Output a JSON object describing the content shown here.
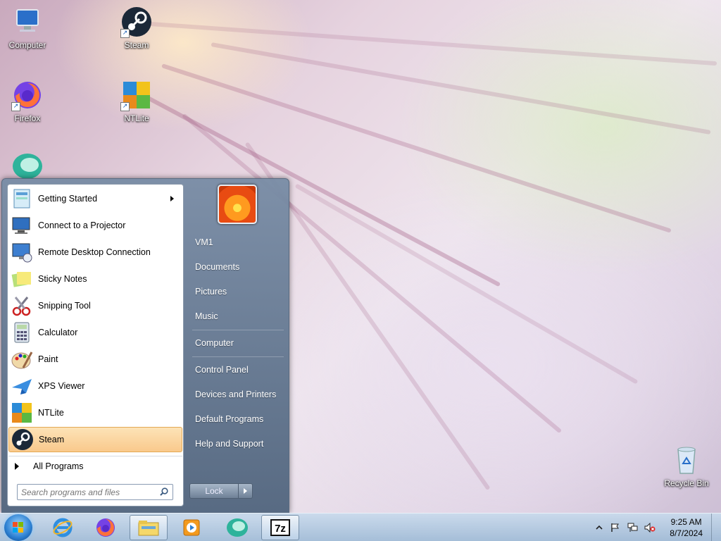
{
  "desktop": {
    "icons": [
      {
        "label": "Computer",
        "icon": "computer-icon"
      },
      {
        "label": "Steam",
        "icon": "steam-icon"
      },
      {
        "label": "Firefox",
        "icon": "firefox-icon"
      },
      {
        "label": "NTLite",
        "icon": "ntlite-icon"
      },
      {
        "label": "",
        "icon": "app-icon"
      },
      {
        "label": "Recycle Bin",
        "icon": "recycle-bin-icon"
      }
    ]
  },
  "start_menu": {
    "programs": [
      {
        "label": "Getting Started",
        "icon": "getting-started-icon",
        "has_submenu": true
      },
      {
        "label": "Connect to a Projector",
        "icon": "projector-icon"
      },
      {
        "label": "Remote Desktop Connection",
        "icon": "remote-desktop-icon"
      },
      {
        "label": "Sticky Notes",
        "icon": "sticky-notes-icon"
      },
      {
        "label": "Snipping Tool",
        "icon": "snipping-tool-icon"
      },
      {
        "label": "Calculator",
        "icon": "calculator-icon"
      },
      {
        "label": "Paint",
        "icon": "paint-icon"
      },
      {
        "label": "XPS Viewer",
        "icon": "xps-viewer-icon"
      },
      {
        "label": "NTLite",
        "icon": "ntlite-icon"
      },
      {
        "label": "Steam",
        "icon": "steam-icon",
        "highlighted": true
      }
    ],
    "all_programs_label": "All Programs",
    "search_placeholder": "Search programs and files",
    "right_links": [
      "VM1",
      "Documents",
      "Pictures",
      "Music",
      "Computer",
      "Control Panel",
      "Devices and Printers",
      "Default Programs",
      "Help and Support"
    ],
    "lock_label": "Lock"
  },
  "taskbar": {
    "pinned": [
      "internet-explorer-icon",
      "firefox-icon",
      "file-explorer-icon",
      "media-player-icon",
      "app-icon",
      "7zip-icon"
    ],
    "clock": {
      "time": "9:25 AM",
      "date": "8/7/2024"
    },
    "tray_icons": [
      "show-hidden-icons-icon",
      "action-center-flag-icon",
      "network-icon",
      "volume-muted-icon"
    ]
  }
}
